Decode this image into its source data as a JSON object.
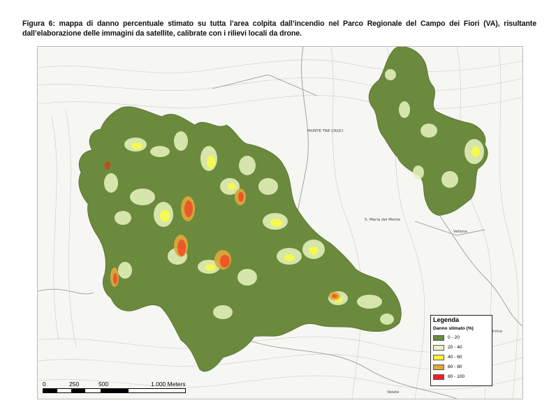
{
  "caption": {
    "line1": "Figura 6: mappa di danno percentuale stimato su tutta l’area colpita dall’incendio nel Parco Regionale del Campo dei Fiori (VA), risultante",
    "line2": "dall’elaborazione delle immagini da satellite, calibrate con i rilievi locali da drone."
  },
  "map": {
    "place_labels": {
      "monte_tre_croci": "MONTE TRE CROCI",
      "santa_maria": "S. Maria del Monte",
      "velate": "Velate",
      "vellone": "Vellone",
      "orrino": "Orrino"
    }
  },
  "legend": {
    "title": "Legenda",
    "subtitle": "Danno stimato (%)",
    "classes": [
      {
        "label": "0 - 20",
        "color": "#6b8a3d"
      },
      {
        "label": "20 - 40",
        "color": "#e8f5c0"
      },
      {
        "label": "40 - 60",
        "color": "#ffff33"
      },
      {
        "label": "60 - 80",
        "color": "#e0a83a"
      },
      {
        "label": "80 - 100",
        "color": "#ff1a1a"
      }
    ]
  },
  "scalebar": {
    "ticks": [
      "0",
      "250",
      "500",
      "1.000 Meters"
    ]
  }
}
